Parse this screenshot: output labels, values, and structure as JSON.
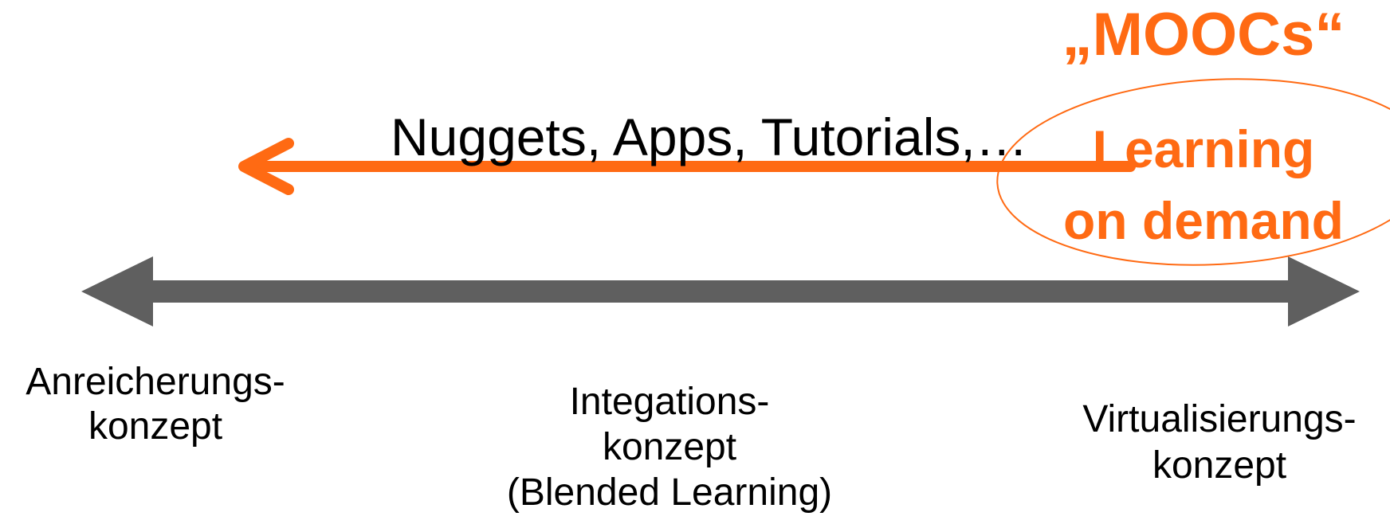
{
  "moocs": {
    "text": "„MOOCs“"
  },
  "nuggets": {
    "text": "Nuggets, Apps, Tutorials,…"
  },
  "learning_on_demand": {
    "line1": "Learning",
    "line2": "on demand"
  },
  "concepts": {
    "left": {
      "line1": "Anreicherungs-",
      "line2": "konzept"
    },
    "middle": {
      "line1": "Integations-",
      "line2": "konzept",
      "line3": "(Blended Learning)"
    },
    "right": {
      "line1": "Virtualisierungs-",
      "line2": "konzept"
    }
  },
  "colors": {
    "accent": "#ff6a13",
    "axis": "#5f5f5f",
    "text": "#000000"
  }
}
